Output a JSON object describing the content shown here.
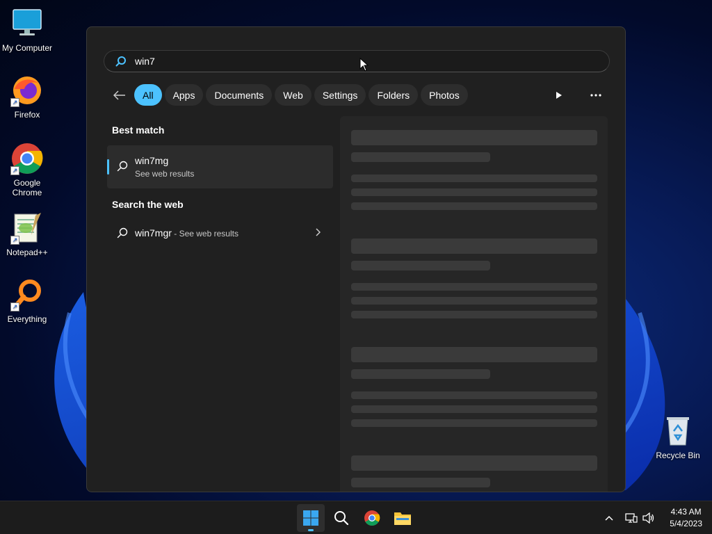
{
  "desktop": {
    "icons": [
      {
        "label": "My Computer"
      },
      {
        "label": "Firefox"
      },
      {
        "label": "Google Chrome"
      },
      {
        "label": "Notepad++"
      },
      {
        "label": "Everything"
      },
      {
        "label": "Recycle Bin"
      }
    ]
  },
  "search": {
    "query": "win7",
    "filters": [
      {
        "label": "All",
        "active": true
      },
      {
        "label": "Apps"
      },
      {
        "label": "Documents"
      },
      {
        "label": "Web"
      },
      {
        "label": "Settings"
      },
      {
        "label": "Folders"
      },
      {
        "label": "Photos"
      }
    ],
    "best_match_heading": "Best match",
    "best_match": {
      "title": "win7mg",
      "subtitle": "See web results"
    },
    "web_heading": "Search the web",
    "web_result": {
      "title": "win7mgr",
      "suffix": " - See web results"
    }
  },
  "taskbar": {
    "time": "4:43 AM",
    "date": "5/4/2023",
    "items": [
      "start-icon",
      "search-icon",
      "chrome-icon",
      "file-explorer-icon"
    ]
  },
  "colors": {
    "accent": "#4cc2ff",
    "panel": "#202020",
    "taskbar": "#1c1c1c"
  }
}
